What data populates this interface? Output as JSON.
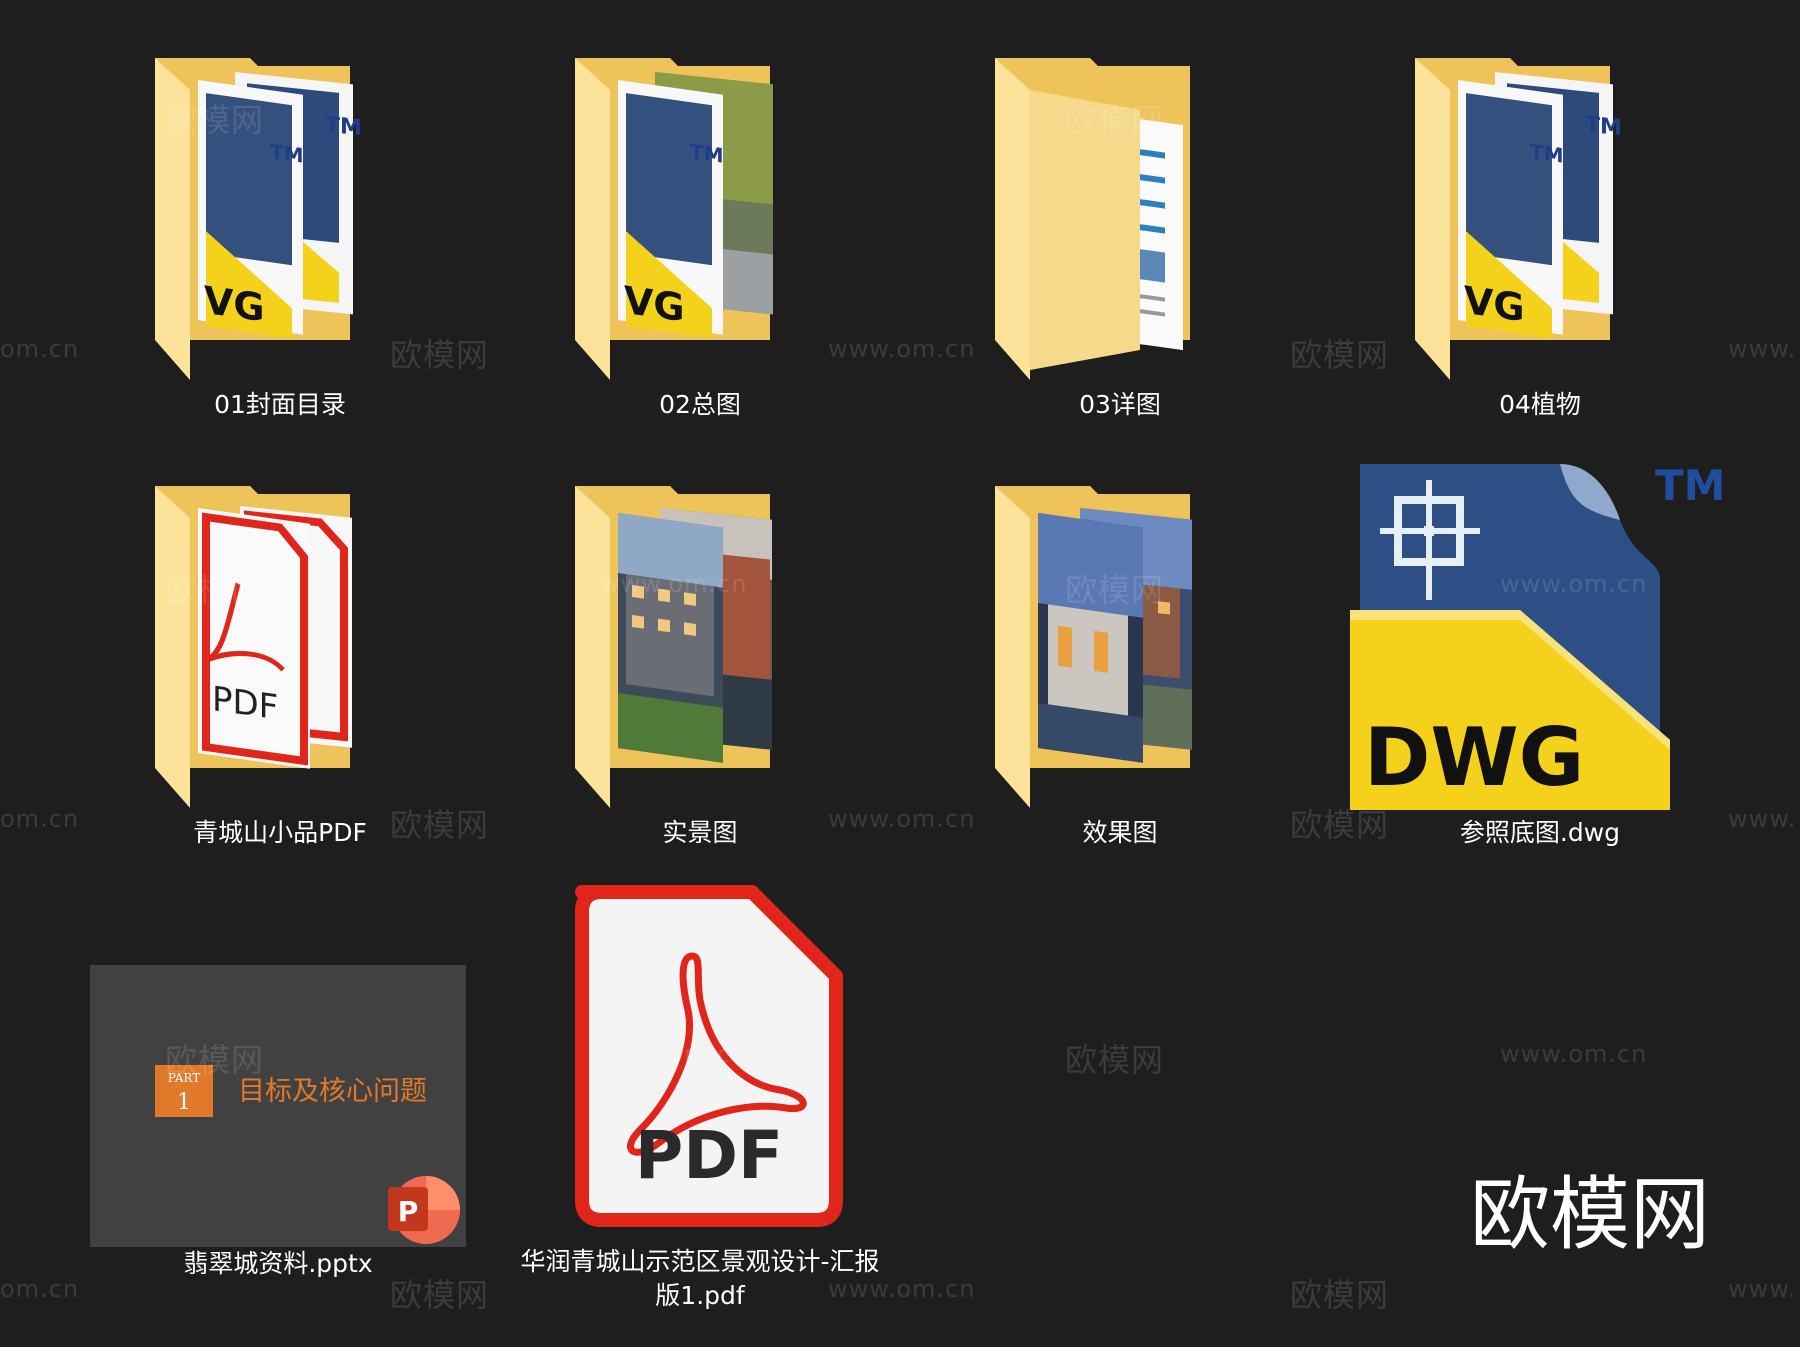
{
  "items": [
    {
      "label": "01封面目录",
      "type": "folder",
      "preview": "dwg"
    },
    {
      "label": "02总图",
      "type": "folder",
      "preview": "dwg-photo"
    },
    {
      "label": "03详图",
      "type": "folder",
      "preview": "document"
    },
    {
      "label": "04植物",
      "type": "folder",
      "preview": "dwg"
    },
    {
      "label": "青城山小品PDF",
      "type": "folder",
      "preview": "pdf"
    },
    {
      "label": "实景图",
      "type": "folder",
      "preview": "photo"
    },
    {
      "label": "效果图",
      "type": "folder",
      "preview": "render"
    },
    {
      "label": "参照底图.dwg",
      "type": "dwg-file"
    },
    {
      "label": "翡翠城资料.pptx",
      "type": "pptx-file"
    },
    {
      "label": "华润青城山示范区景观设计-汇报版1.pdf",
      "type": "pdf-file"
    }
  ],
  "icon_text": {
    "dwg": "DWG",
    "dwg_short": "VG",
    "tm": "TM",
    "pdf": "PDF",
    "part": "PART",
    "part_num": "1",
    "slide_title": "目标及核心问题",
    "ppt_letter": "P"
  },
  "watermarks": {
    "brand": "欧模网",
    "url": "www.om.cn",
    "url_cut": "om.cn",
    "url_cut_right": "www."
  },
  "colors": {
    "background": "#1e1e1e",
    "folder_back": "#f0c659",
    "folder_front": "#fde8a3",
    "dwg_yellow": "#f4d21b",
    "dwg_blue": "#2f4f86",
    "pdf_red": "#e0261b",
    "ppt_orange": "#d24726"
  }
}
